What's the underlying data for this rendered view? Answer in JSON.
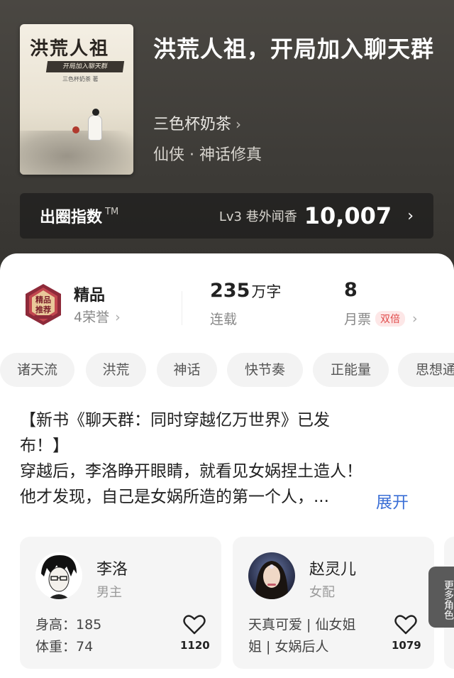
{
  "book": {
    "cover": {
      "title": "洪荒人祖",
      "subtitle": "开局加入聊天群",
      "author": "三色杯奶茶 著"
    },
    "title": "洪荒人祖，开局加入聊天群",
    "author": "三色杯奶茶",
    "genre": "仙侠 · 神话修真"
  },
  "circle_index": {
    "label": "出圈指数",
    "tm": "TM",
    "level": "Lv3 巷外闻香",
    "value": "10,007"
  },
  "stats": {
    "quality": {
      "badge_text": "精品 推荐",
      "title": "精品",
      "honor": "4荣誉"
    },
    "words": {
      "number": "235",
      "unit": "万字",
      "status": "连载"
    },
    "tickets": {
      "number": "8",
      "label": "月票",
      "double": "双倍"
    }
  },
  "tags": [
    "诸天流",
    "洪荒",
    "神话",
    "快节奏",
    "正能量",
    "思想通"
  ],
  "intro": {
    "line1": "【新书《聊天群：同时穿越亿万世界》已发",
    "line2": "布！】",
    "line3": "穿越后，李洛睁开眼睛，就看见女娲捏土造人！",
    "line4": "他才发现，自己是女娲所造的第一个人，...",
    "expand": "展开"
  },
  "characters": [
    {
      "name": "李洛",
      "role": "男主",
      "attr1": "身高：185",
      "attr2": "体重：74",
      "likes": "1120"
    },
    {
      "name": "赵灵儿",
      "role": "女配",
      "attr1": "天真可爱 | 仙女姐",
      "attr2": "姐 | 女娲后人",
      "likes": "1079"
    }
  ],
  "more_roles": "更多角色",
  "colors": {
    "accent": "#3b6fd6",
    "double_badge": "#e04a4a",
    "hero_bg": "#43413d"
  }
}
